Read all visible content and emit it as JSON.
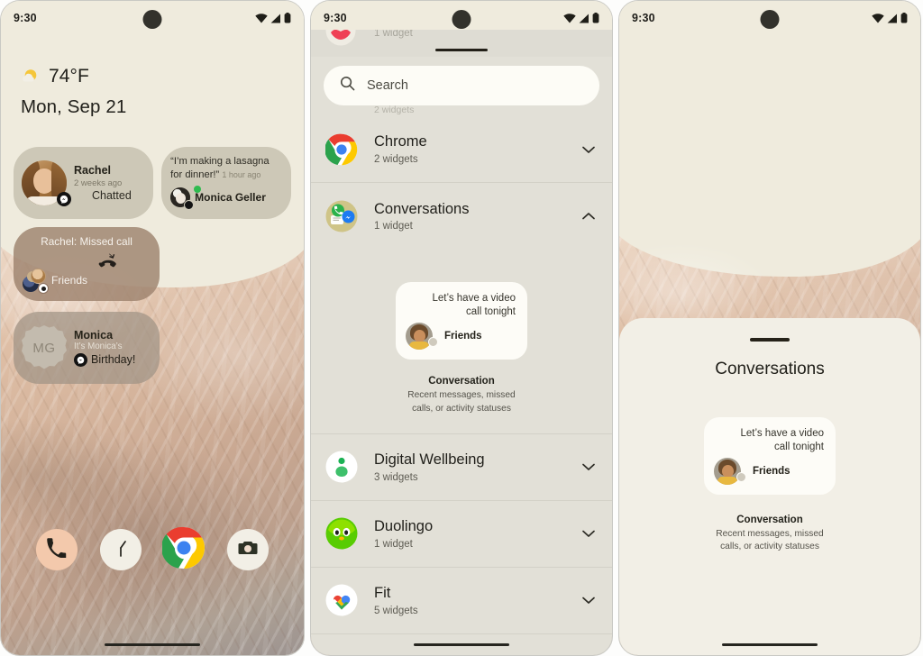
{
  "status_bar": {
    "time": "9:30",
    "icons": [
      "wifi-icon",
      "signal-icon",
      "battery-icon"
    ]
  },
  "home": {
    "weather": {
      "icon": "sun-cloud-icon",
      "temperature": "74°F"
    },
    "date": "Mon, Sep 21",
    "widgets": [
      {
        "name": "rachel-conversation-widget",
        "person": "Rachel",
        "time": "2 weeks ago",
        "status": "Chatted",
        "badge": "messenger-icon",
        "avatar": "rachel-photo-avatar"
      },
      {
        "name": "monica-geller-quote-widget",
        "quote": "“I’m making a lasagna for dinner!”",
        "time": "1 hour ago",
        "person": "Monica Geller",
        "presence": "online",
        "badge": "messages-icon"
      },
      {
        "name": "friends-missed-call-widget",
        "title": "Rachel: Missed call",
        "icon": "missed-call-icon",
        "group": "Friends",
        "badge": "messages-icon"
      },
      {
        "name": "monica-birthday-widget",
        "initials": "MG",
        "person": "Monica",
        "line1": "It’s Monica’s",
        "line2": "Birthday!",
        "badge": "messenger-icon"
      }
    ],
    "dock": [
      {
        "name": "phone-app",
        "icon": "phone-icon"
      },
      {
        "name": "clock-app",
        "icon": "clock-icon"
      },
      {
        "name": "chrome-app",
        "icon": "chrome-icon"
      },
      {
        "name": "camera-app",
        "icon": "camera-icon"
      }
    ]
  },
  "picker": {
    "peek_row": {
      "count": "1 widget",
      "icon": "lips-icon"
    },
    "search": {
      "placeholder": "Search",
      "icon": "search-icon"
    },
    "behind_search_count": "2 widgets",
    "apps": [
      {
        "name": "chrome",
        "title": "Chrome",
        "count": "2 widgets",
        "icon": "chrome-icon",
        "chevron": "chevron-down-icon",
        "expanded": false
      },
      {
        "name": "conversations",
        "title": "Conversations",
        "count": "1 widget",
        "icon": "conversations-icon",
        "chevron": "chevron-up-icon",
        "expanded": true
      },
      {
        "name": "digital-wellbeing",
        "title": "Digital Wellbeing",
        "count": "3 widgets",
        "icon": "digital-wellbeing-icon",
        "chevron": "chevron-down-icon",
        "expanded": false
      },
      {
        "name": "duolingo",
        "title": "Duolingo",
        "count": "1 widget",
        "icon": "duolingo-icon",
        "chevron": "chevron-down-icon",
        "expanded": false
      },
      {
        "name": "fit",
        "title": "Fit",
        "count": "5 widgets",
        "icon": "fit-icon",
        "chevron": "chevron-down-icon",
        "expanded": false
      }
    ],
    "preview": {
      "message_line1": "Let’s have a video",
      "message_line2": "call tonight",
      "person": "Friends",
      "caption_title": "Conversation",
      "caption_desc_line1": "Recent messages, missed",
      "caption_desc_line2": "calls, or activity statuses"
    }
  },
  "detail_sheet": {
    "handle": "drag-handle",
    "title": "Conversations",
    "preview": {
      "message_line1": "Let’s have a video",
      "message_line2": "call tonight",
      "person": "Friends",
      "caption_title": "Conversation",
      "caption_desc_line1": "Recent messages, missed",
      "caption_desc_line2": "calls, or activity statuses"
    }
  },
  "colors": {
    "wallpaper_sky": "#efebdd",
    "sheet_bg": "#e2e0d7",
    "card_bg": "#fdfcf7",
    "widget_tan": "#cdc8b7",
    "accent_green": "#2fbb4f"
  }
}
